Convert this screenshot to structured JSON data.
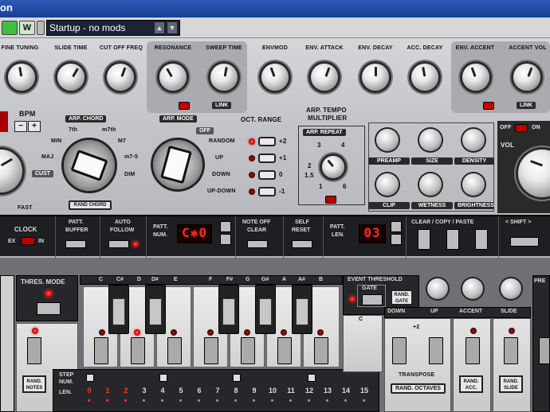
{
  "window": {
    "title_fragment": "on"
  },
  "toolbar": {
    "m_label": "",
    "w_label": "W",
    "preset": "Startup - no mods",
    "preset_btn1": "▲",
    "preset_btn2": "▼"
  },
  "knobs_top": [
    "FINE TUNING",
    "SLIDE TIME",
    "CUT OFF FREQ",
    "RESONANCE",
    "SWEEP TIME",
    "ENVMOD",
    "ENV. ATTACK",
    "ENV. DECAY",
    "ACC. DECAY",
    "ENV. ACCENT",
    "ACCENT VOL"
  ],
  "link": "LINK",
  "bpm": {
    "label": "BPM",
    "minus": "−",
    "plus": "+"
  },
  "arp_chord": {
    "title": "ARP. CHORD",
    "opts": [
      "7th",
      "m7th",
      "MIN",
      "M7",
      "MAJ",
      "m7-5",
      "CUST",
      "DIM"
    ],
    "rand": "RAND CHORD",
    "fast": "FAST"
  },
  "arp_mode": {
    "title": "ARP. MODE",
    "off": "OFF",
    "opts": [
      "RANDOM",
      "UP",
      "DOWN",
      "UP-DOWN"
    ]
  },
  "oct_range": {
    "title": "OCT. RANGE",
    "opts": [
      "+2",
      "+1",
      "0",
      "-1"
    ]
  },
  "arp_tempo": {
    "title1": "ARP. TEMPO",
    "title2": "MULTIPLIER",
    "repeat": "ARP. REPEAT",
    "nums": [
      "3",
      "4",
      "2",
      "1.5",
      "1",
      "6"
    ]
  },
  "fx": {
    "knobs": [
      "PREAMP",
      "SIZE",
      "DENSITY",
      "CLIP",
      "WETNESS",
      "BRIGHTNESS"
    ]
  },
  "vol": {
    "label": "VOL",
    "off": "OFF",
    "on": "ON"
  },
  "strip": {
    "clock": "CLOCK",
    "ex": "EX",
    "in": "IN",
    "patt_buffer": [
      "PATT.",
      "BUFFER"
    ],
    "auto_follow": [
      "AUTO",
      "FOLLOW"
    ],
    "patt_num": [
      "PATT.",
      "NUM."
    ],
    "patt_num_val": "C✱0",
    "note_off": [
      "NOTE OFF",
      "CLEAR"
    ],
    "self_reset": [
      "SELF",
      "RESET"
    ],
    "patt_len": [
      "PATT.",
      "LEN."
    ],
    "patt_len_val": "03",
    "ccp": "CLEAR / COPY / PASTE",
    "shift": "< SHIFT >"
  },
  "keyboard": {
    "thres_mode": "THRES. MODE",
    "note_names": [
      "C",
      "C#",
      "D",
      "D#",
      "E",
      "F",
      "F#",
      "G",
      "G#",
      "A",
      "A#",
      "B",
      "C"
    ],
    "rand_notes": [
      "RAND.",
      "NOTES"
    ],
    "step_num": [
      "STEP",
      "NUM."
    ],
    "len": "LEN.",
    "steps": [
      "0",
      "1",
      "2",
      "3",
      "4",
      "5",
      "6",
      "7",
      "8",
      "9",
      "10",
      "11",
      "12",
      "13",
      "14",
      "15"
    ],
    "event_threshold": "EVENT THRESHOLD",
    "gate": "GATE",
    "rand_gate": [
      "RAND.",
      "GATE"
    ],
    "down": "DOWN",
    "up": "UP",
    "plus2": "+2",
    "transpose": "TRANSPOSE",
    "rand_octaves": "RAND. OCTAVES",
    "accent": "ACCENT",
    "slide": "SLIDE",
    "rand_acc": [
      "RAND.",
      "ACC."
    ],
    "rand_slide": [
      "RAND.",
      "SLIDE"
    ],
    "pre": "PRE"
  }
}
